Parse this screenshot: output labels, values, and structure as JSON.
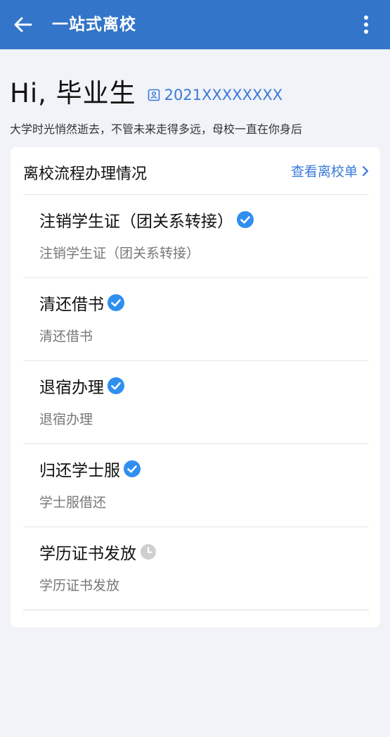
{
  "appbar": {
    "title": "一站式离校",
    "back_icon": "arrow-left-icon",
    "more_icon": "more-vert-icon"
  },
  "greeting": {
    "hi": "Hi, 毕业生",
    "student_id_icon": "id-card-icon",
    "student_id": "2021XXXXXXXX",
    "tagline": "大学时光悄然逝去，不管未来走得多远，母校一直在你身后"
  },
  "card": {
    "title": "离校流程办理情况",
    "view_link": "查看离校单",
    "view_link_icon": "chevron-right-icon",
    "steps": [
      {
        "title": "注销学生证（团关系转接）",
        "subtitle": "注销学生证（团关系转接）",
        "status": "done",
        "status_icon": "check-circle-icon"
      },
      {
        "title": "清还借书",
        "subtitle": "清还借书",
        "status": "done",
        "status_icon": "check-circle-icon"
      },
      {
        "title": "退宿办理",
        "subtitle": "退宿办理",
        "status": "done",
        "status_icon": "check-circle-icon"
      },
      {
        "title": "归还学士服",
        "subtitle": "学士服借还",
        "status": "done",
        "status_icon": "check-circle-icon"
      },
      {
        "title": "学历证书发放",
        "subtitle": "学历证书发放",
        "status": "pending",
        "status_icon": "clock-icon"
      }
    ]
  },
  "colors": {
    "appbar": "#3375c8",
    "accent": "#3a7ad9",
    "check": "#2f8ff0",
    "pending": "#cfcfcf",
    "background": "#f1f3f8"
  }
}
